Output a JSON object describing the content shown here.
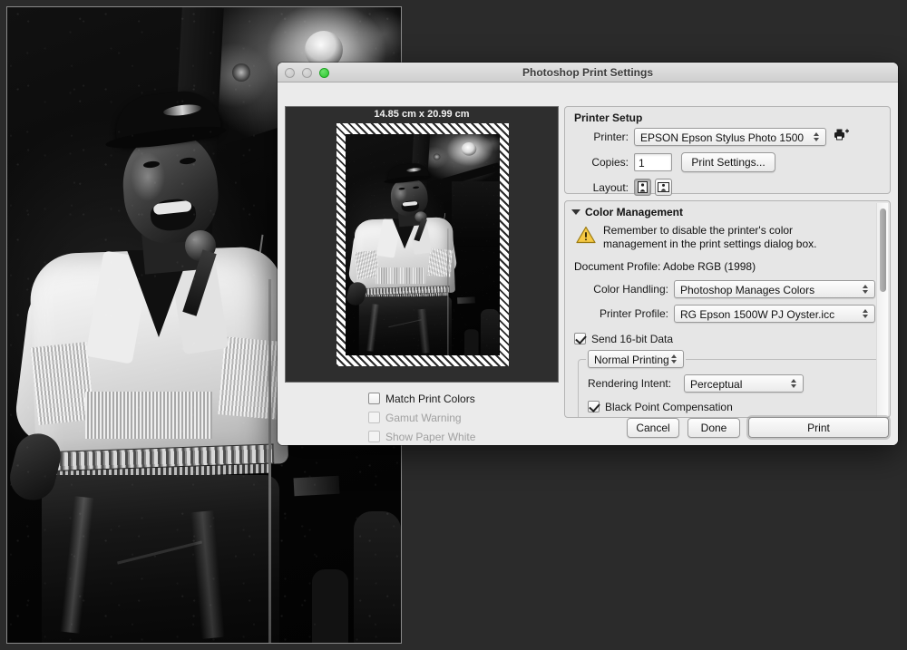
{
  "window": {
    "title": "Photoshop Print Settings",
    "traffic_lights": [
      "close",
      "minimize",
      "zoom"
    ]
  },
  "preview": {
    "dimensions_label": "14.85 cm x 20.99 cm"
  },
  "left_options": [
    {
      "label": "Match Print Colors",
      "checked": false,
      "enabled": true
    },
    {
      "label": "Gamut Warning",
      "checked": false,
      "enabled": false
    },
    {
      "label": "Show Paper White",
      "checked": false,
      "enabled": false
    }
  ],
  "printer_setup": {
    "title": "Printer Setup",
    "printer_label": "Printer:",
    "printer_value": "EPSON Epson Stylus Photo 1500",
    "add_printer_icon": "printer-add-icon",
    "copies_label": "Copies:",
    "copies_value": "1",
    "print_settings_button": "Print Settings...",
    "layout_label": "Layout:",
    "layout_portrait_icon": "orientation-portrait-icon",
    "layout_landscape_icon": "orientation-landscape-icon",
    "layout_selected": "portrait"
  },
  "color_management": {
    "title": "Color Management",
    "disclosure": "expanded",
    "warning_icon": "warning-triangle-icon",
    "warning_text_line1": "Remember to disable the printer's color",
    "warning_text_line2": "management in the print settings dialog box.",
    "document_profile": "Document Profile: Adobe RGB (1998)",
    "color_handling_label": "Color Handling:",
    "color_handling_value": "Photoshop Manages Colors",
    "printer_profile_label": "Printer Profile:",
    "printer_profile_value": "RG Epson 1500W PJ Oyster.icc",
    "send_16bit_label": "Send 16-bit Data",
    "send_16bit_checked": true,
    "print_mode_value": "Normal Printing",
    "rendering_intent_label": "Rendering Intent:",
    "rendering_intent_value": "Perceptual",
    "black_point_label": "Black Point Compensation",
    "black_point_checked": true
  },
  "footer": {
    "cancel": "Cancel",
    "done": "Done",
    "print": "Print"
  },
  "colors": {
    "dialog_bg": "#ebebeb",
    "group_bg": "#e6e6e6",
    "preview_bg": "#2e2e2e",
    "warning_yellow": "#f2c12e",
    "zoom_green": "#27c52b",
    "desktop_bg": "#2b2b2b"
  }
}
